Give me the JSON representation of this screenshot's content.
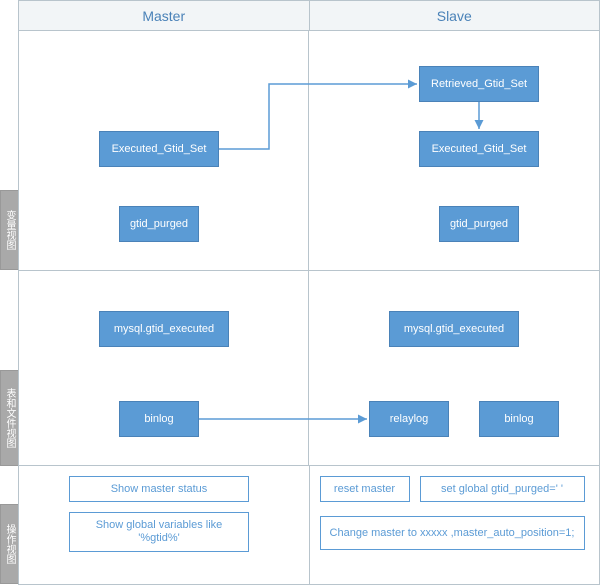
{
  "headers": {
    "master": "Master",
    "slave": "Slave"
  },
  "vtabs": {
    "vars": "变量视图",
    "files": "表和文件视图",
    "ops": "操作视图"
  },
  "master_vars": {
    "executed": "Executed_Gtid_Set",
    "purged": "gtid_purged"
  },
  "slave_vars": {
    "retrieved": "Retrieved_Gtid_Set",
    "executed": "Executed_Gtid_Set",
    "purged": "gtid_purged"
  },
  "master_files": {
    "table": "mysql.gtid_executed",
    "binlog": "binlog"
  },
  "slave_files": {
    "table": "mysql.gtid_executed",
    "relaylog": "relaylog",
    "binlog": "binlog"
  },
  "master_ops": {
    "status": "Show master status",
    "globals": "Show global variables like '%gtid%'"
  },
  "slave_ops": {
    "reset": "reset master",
    "set_purged": "set global gtid_purged=' '",
    "change_master": "Change master to xxxxx ,master_auto_position=1;"
  }
}
